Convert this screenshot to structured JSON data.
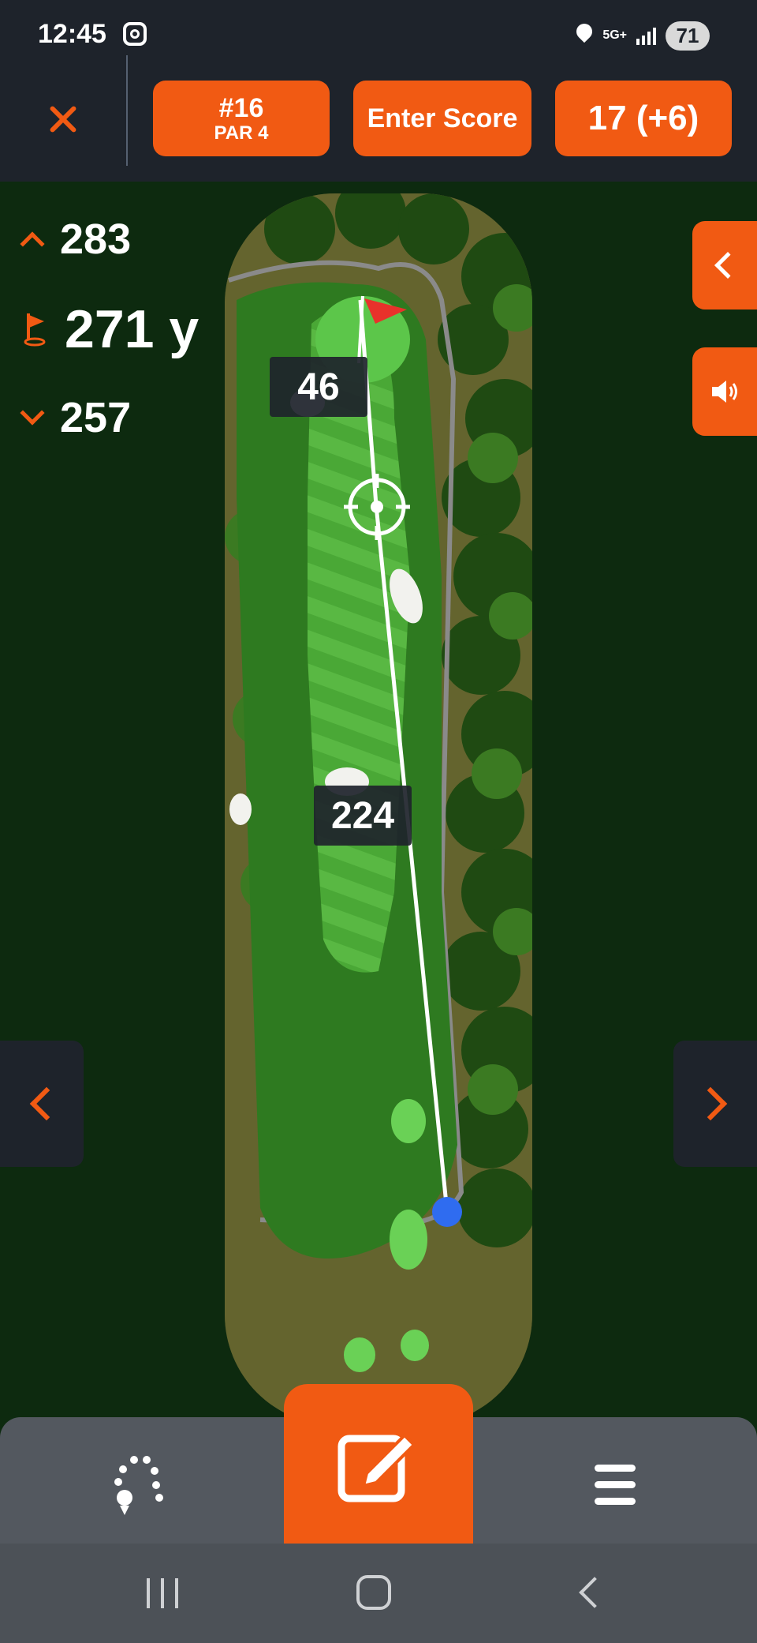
{
  "status_bar": {
    "time": "12:45",
    "app_icon": "instagram-icon",
    "network": "5G+",
    "battery": "71"
  },
  "header": {
    "close_icon": "close-icon",
    "hole_label": "#16",
    "par_label": "PAR 4",
    "enter_score_label": "Enter Score",
    "score_label": "17 (+6)"
  },
  "distances": {
    "back": "283",
    "pin": "271 y",
    "front": "257"
  },
  "map": {
    "target_to_green_label": "46",
    "tee_to_target_label": "224"
  },
  "toolbar": {
    "shots_icon": "shot-tracker-icon",
    "edit_icon": "edit-score-icon",
    "menu_icon": "menu-icon"
  },
  "colors": {
    "accent": "#f15a13",
    "header_bg": "#1e232b",
    "background": "#0d2a0f",
    "fairway": "#3f9a2c",
    "rough": "#2e7a20",
    "player_dot": "#2f6cf0"
  }
}
